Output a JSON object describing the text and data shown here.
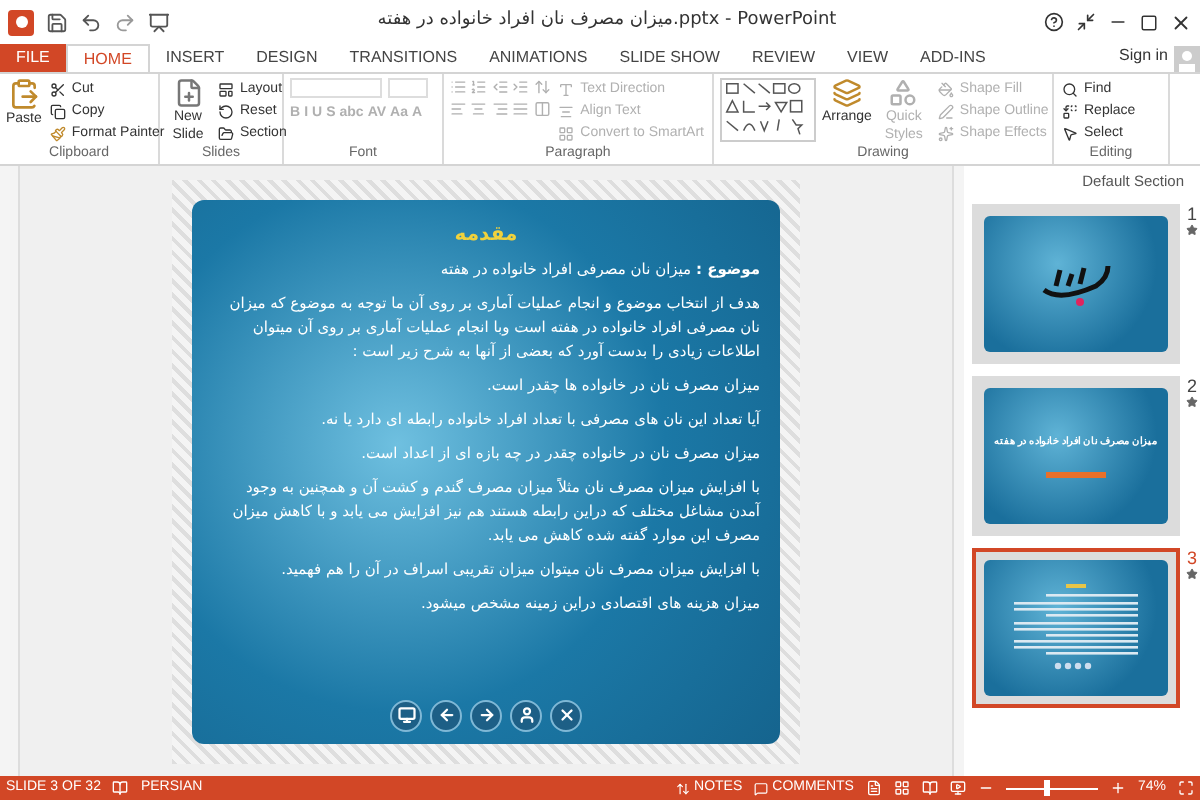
{
  "window": {
    "title": "میزان مصرف نان افراد خانواده در هفته.pptx - PowerPoint",
    "sign_in": "Sign in"
  },
  "tabs": [
    {
      "label": "FILE",
      "kind": "file",
      "selected": false
    },
    {
      "label": "HOME",
      "kind": "tab",
      "selected": true
    },
    {
      "label": "INSERT",
      "kind": "tab",
      "selected": false
    },
    {
      "label": "DESIGN",
      "kind": "tab",
      "selected": false
    },
    {
      "label": "TRANSITIONS",
      "kind": "tab",
      "selected": false
    },
    {
      "label": "ANIMATIONS",
      "kind": "tab",
      "selected": false
    },
    {
      "label": "SLIDE SHOW",
      "kind": "tab",
      "selected": false
    },
    {
      "label": "REVIEW",
      "kind": "tab",
      "selected": false
    },
    {
      "label": "VIEW",
      "kind": "tab",
      "selected": false
    },
    {
      "label": "ADD-INS",
      "kind": "tab",
      "selected": false
    }
  ],
  "ribbon": {
    "clipboard": {
      "label": "Clipboard",
      "paste": "Paste",
      "cut": "Cut",
      "copy": "Copy",
      "format_painter": "Format Painter"
    },
    "slides": {
      "label": "Slides",
      "new_slide": "New Slide",
      "layout": "Layout",
      "reset": "Reset",
      "section": "Section"
    },
    "font": {
      "label": "Font",
      "disabled": true,
      "glyphs": [
        "B",
        "I",
        "U",
        "S",
        "abc",
        "AV",
        "Aa",
        "A"
      ]
    },
    "paragraph": {
      "label": "Paragraph",
      "disabled": true,
      "text_direction": "Text Direction",
      "align_text": "Align Text",
      "convert": "Convert to SmartArt"
    },
    "drawing": {
      "label": "Drawing",
      "arrange": "Arrange",
      "quick_styles": "Quick Styles",
      "shape_fill": "Shape Fill",
      "shape_outline": "Shape Outline",
      "shape_effects": "Shape Effects",
      "disabled": true
    },
    "editing": {
      "label": "Editing",
      "find": "Find",
      "replace": "Replace",
      "select": "Select"
    }
  },
  "slide": {
    "title": "مقدمه",
    "paragraphs": [
      "**موضوع :** میزان نان مصرفی افراد خانواده در هفته",
      "هدف از انتخاب موضوع و انجام عملیات آماری بر روی آن ما توجه به موضوع که میزان نان مصرفی افراد خانواده در هفته است وبا انجام عملیات آماری بر روی آن میتوان اطلاعات زیادی را بدست آورد که بعضی از آنها به شرح زیر است :",
      "میزان مصرف نان در خانواده ها چقدر است.",
      "آیا تعداد این نان های مصرفی با تعداد افراد خانواده رابطه ای دارد یا نه.",
      "میزان مصرف نان در خانواده چقدر در چه بازه ای از اعداد است.",
      "با افزایش میزان مصرف نان مثلاً میزان مصرف گندم و کشت آن و همچنین به وجود آمدن مشاغل مختلف که دراین رابطه هستند هم نیز افزایش می یابد و با کاهش میزان مصرف این موارد گفته شده کاهش می یابد.",
      "با افزایش میزان مصرف نان میتوان میزان تقریبی اسراف در آن را هم فهمید.",
      "میزان هزینه های اقتصادی دراین زمینه مشخص میشود."
    ]
  },
  "thumbnails": {
    "section": "Default Section",
    "slides": [
      {
        "number": "1",
        "kind": "calligraphy",
        "selected": false
      },
      {
        "number": "2",
        "kind": "title",
        "title": "میزان مصرف نان افراد خانواده در هفته",
        "selected": false
      },
      {
        "number": "3",
        "kind": "text",
        "selected": true
      }
    ]
  },
  "status_bar": {
    "slide_counter": "SLIDE 3 OF 32",
    "language": "PERSIAN",
    "notes": "NOTES",
    "comments": "COMMENTS",
    "zoom": "74%",
    "zoom_slider": {
      "level": 0.45
    }
  }
}
